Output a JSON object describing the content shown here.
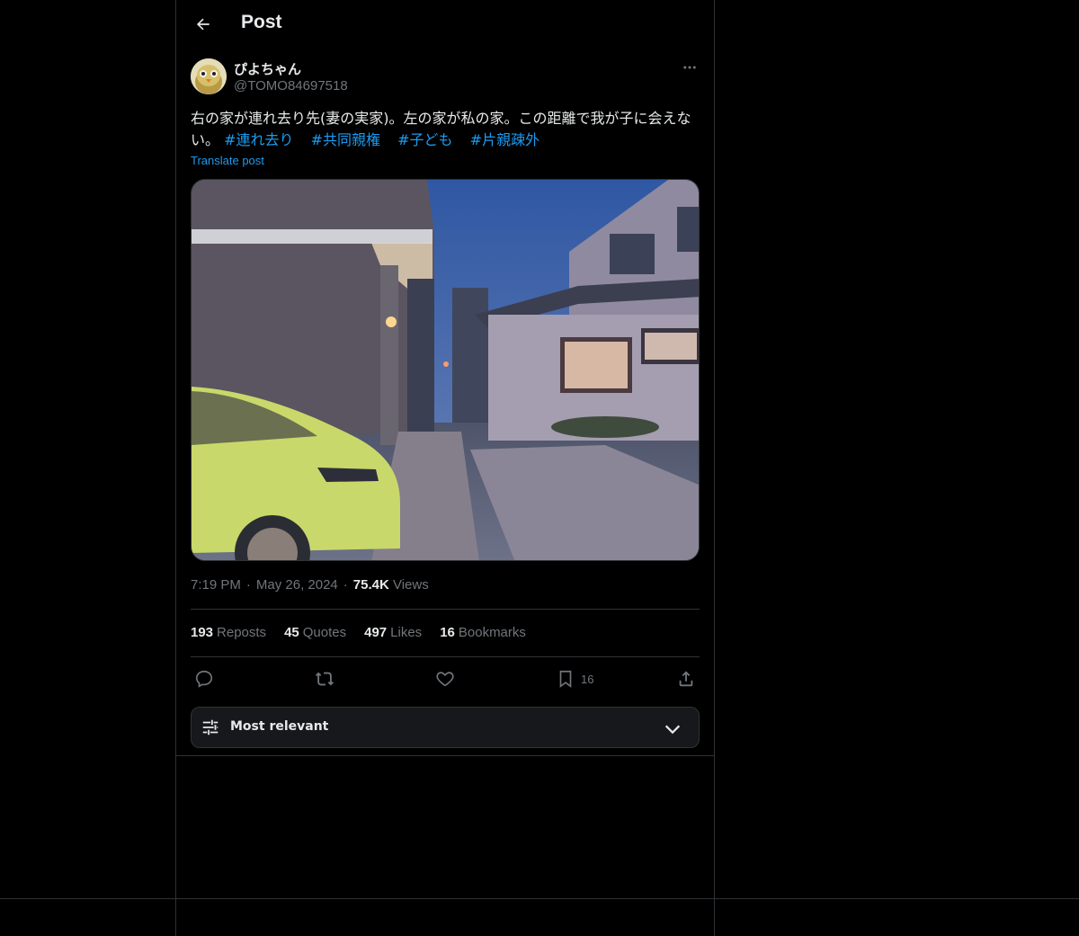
{
  "header": {
    "title": "Post"
  },
  "author": {
    "display_name": "ぴよちゃん",
    "handle": "@TOMO84697518"
  },
  "post": {
    "text": "右の家が連れ去り先(妻の実家)。左の家が私の家。この距離で我が子に会えない。",
    "hashtags": [
      "#連れ去り",
      "#共同親権",
      "#子ども",
      "#片親疎外"
    ],
    "translate_label": "Translate post"
  },
  "meta": {
    "time": "7:19 PM",
    "date": "May 26, 2024",
    "views_count": "75.4K",
    "views_label": "Views",
    "sep": "·"
  },
  "stats": [
    {
      "count": "193",
      "label": "Reposts"
    },
    {
      "count": "45",
      "label": "Quotes"
    },
    {
      "count": "497",
      "label": "Likes"
    },
    {
      "count": "16",
      "label": "Bookmarks"
    }
  ],
  "actions": {
    "bookmark_count": "16"
  },
  "sort": {
    "label": "Most relevant"
  },
  "colors": {
    "background": "#000000",
    "accent": "#1d9bf0",
    "border": "#2f3336",
    "muted": "#71767b",
    "text": "#e7e9ea"
  },
  "icons": [
    "back-arrow-icon",
    "more-icon",
    "reply-icon",
    "repost-icon",
    "like-icon",
    "bookmark-icon",
    "share-icon",
    "sliders-icon",
    "chevron-down-icon"
  ]
}
